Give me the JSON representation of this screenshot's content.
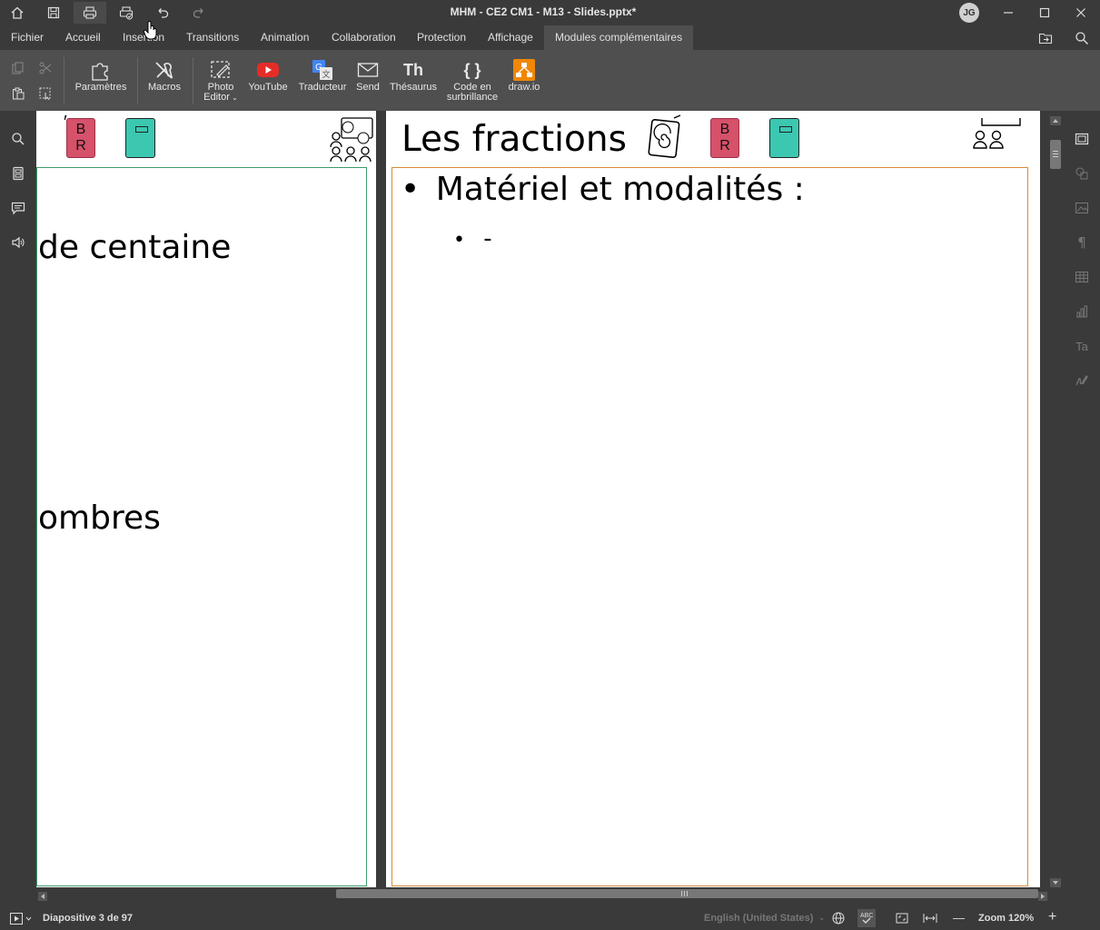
{
  "window": {
    "title": "MHM - CE2 CM1 - M13 - Slides.pptx*",
    "user_initials": "JG"
  },
  "menu": {
    "items": [
      "Fichier",
      "Accueil",
      "Insertion",
      "Transitions",
      "Animation",
      "Collaboration",
      "Protection",
      "Affichage",
      "Modules complémentaires"
    ],
    "active": "Modules complémentaires"
  },
  "toolbar": {
    "parametres": "Paramètres",
    "macros": "Macros",
    "photo_editor_1": "Photo",
    "photo_editor_2": "Editor",
    "youtube": "YouTube",
    "traducteur": "Traducteur",
    "send": "Send",
    "thesaurus": "Thésaurus",
    "thesaurus_glyph": "Th",
    "code_1": "Code en",
    "code_2": "surbrillance",
    "code_glyph": "{ }",
    "drawio": "draw.io"
  },
  "slide_left": {
    "line1": "de centaine",
    "line2": "ombres",
    "br_top": "B",
    "br_bottom": "R"
  },
  "slide_right": {
    "title": "Les fractions",
    "bullet1": "Matériel et modalités :",
    "bullet2": "-",
    "br_top": "B",
    "br_bottom": "R"
  },
  "status": {
    "slide_counter": "Diapositive 3 de 97",
    "language": "English (United States)",
    "zoom": "Zoom 120%"
  },
  "colors": {
    "left_frame": "#3a9c6b",
    "right_frame": "#d98a3a",
    "br_card": "#d6516a",
    "book_card": "#3cc7b1",
    "youtube_red": "#e52d27",
    "drawio_orange": "#f08705",
    "translate_blue": "#4285f4"
  }
}
